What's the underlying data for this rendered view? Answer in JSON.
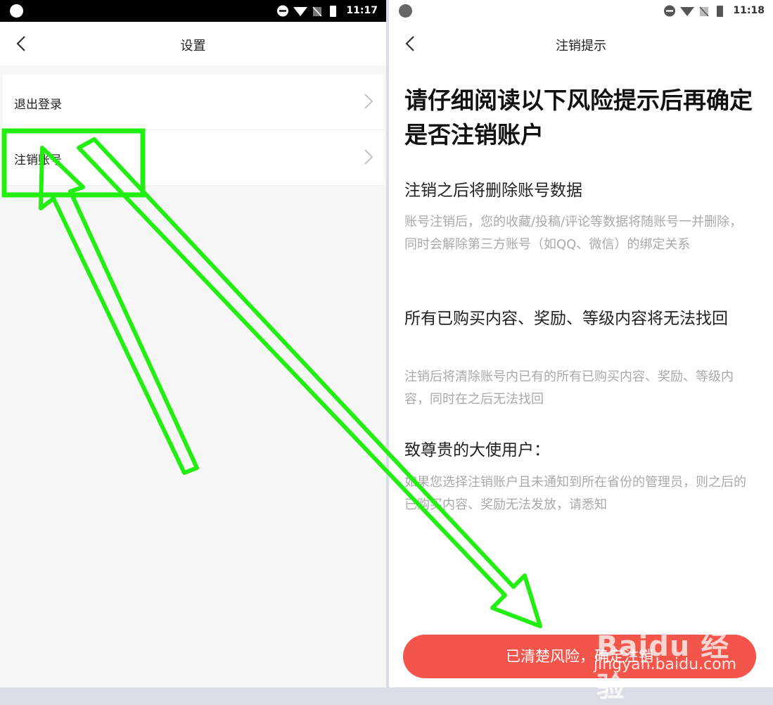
{
  "left_screen": {
    "status_time": "11:17",
    "nav_title": "设置",
    "items": [
      {
        "label": "退出登录"
      },
      {
        "label": "注销账号"
      }
    ]
  },
  "right_screen": {
    "status_time": "11:18",
    "nav_title": "注销提示",
    "headline": "请仔细阅读以下风险提示后再确定是否注销账户",
    "sections": [
      {
        "title": "注销之后将删除账号数据",
        "body": "账号注销后，您的收藏/投稿/评论等数据将随账号一并删除，同时会解除第三方账号（如QQ、微信）的绑定关系"
      },
      {
        "title": "所有已购买内容、奖励、等级内容将无法找回",
        "body": "注销后将清除账号内已有的所有已购买内容、奖励、等级内容，同时在之后无法找回"
      },
      {
        "title": "致尊贵的大使用户：",
        "body": "如果您选择注销账户且未通知到所在省份的管理员，则之后的已购买内容、奖励无法发放，请悉知"
      }
    ],
    "confirm_button": "已清楚风险，确定注销"
  },
  "watermark": {
    "brand": "Baidu 经验",
    "url": "jingyan.baidu.com"
  },
  "colors": {
    "accent_red": "#f4554a",
    "annotation_green": "#22ee11"
  },
  "icons": {
    "back": "chevron-left-icon",
    "row_arrow": "chevron-right-icon"
  }
}
